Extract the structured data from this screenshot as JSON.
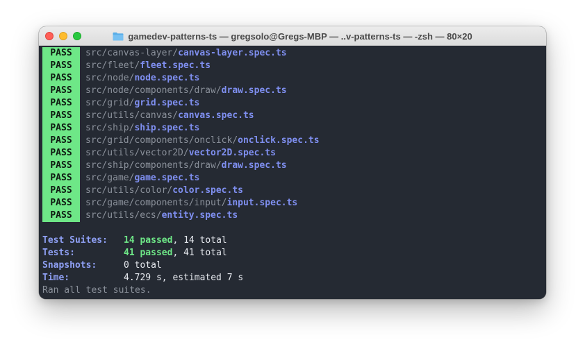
{
  "window": {
    "title": "gamedev-patterns-ts — gregsolo@Gregs-MBP — ..v-patterns-ts — -zsh — 80×20"
  },
  "results": [
    {
      "status": "PASS",
      "dir": "src/canvas-layer/",
      "file": "canvas-layer.spec.ts"
    },
    {
      "status": "PASS",
      "dir": "src/fleet/",
      "file": "fleet.spec.ts"
    },
    {
      "status": "PASS",
      "dir": "src/node/",
      "file": "node.spec.ts"
    },
    {
      "status": "PASS",
      "dir": "src/node/components/draw/",
      "file": "draw.spec.ts"
    },
    {
      "status": "PASS",
      "dir": "src/grid/",
      "file": "grid.spec.ts"
    },
    {
      "status": "PASS",
      "dir": "src/utils/canvas/",
      "file": "canvas.spec.ts"
    },
    {
      "status": "PASS",
      "dir": "src/ship/",
      "file": "ship.spec.ts"
    },
    {
      "status": "PASS",
      "dir": "src/grid/components/onclick/",
      "file": "onclick.spec.ts"
    },
    {
      "status": "PASS",
      "dir": "src/utils/vector2D/",
      "file": "vector2D.spec.ts"
    },
    {
      "status": "PASS",
      "dir": "src/ship/components/draw/",
      "file": "draw.spec.ts"
    },
    {
      "status": "PASS",
      "dir": "src/game/",
      "file": "game.spec.ts"
    },
    {
      "status": "PASS",
      "dir": "src/utils/color/",
      "file": "color.spec.ts"
    },
    {
      "status": "PASS",
      "dir": "src/game/components/input/",
      "file": "input.spec.ts"
    },
    {
      "status": "PASS",
      "dir": "src/utils/ecs/",
      "file": "entity.spec.ts"
    }
  ],
  "summary": {
    "suites_label": "Test Suites:",
    "suites_passed": "14 passed",
    "suites_total": ", 14 total",
    "tests_label": "Tests:",
    "tests_passed": "41 passed",
    "tests_total": ", 41 total",
    "snapshots_label": "Snapshots:",
    "snapshots_value": "0 total",
    "time_label": "Time:",
    "time_value": "4.729 s, estimated 7 s",
    "footer": "Ran all test suites."
  },
  "colors": {
    "terminal_bg": "#252a33",
    "pass_badge": "#6ee787",
    "file_name": "#7f8ff0",
    "label": "#8fa0f5"
  },
  "icons": {
    "title": "folder-icon"
  }
}
